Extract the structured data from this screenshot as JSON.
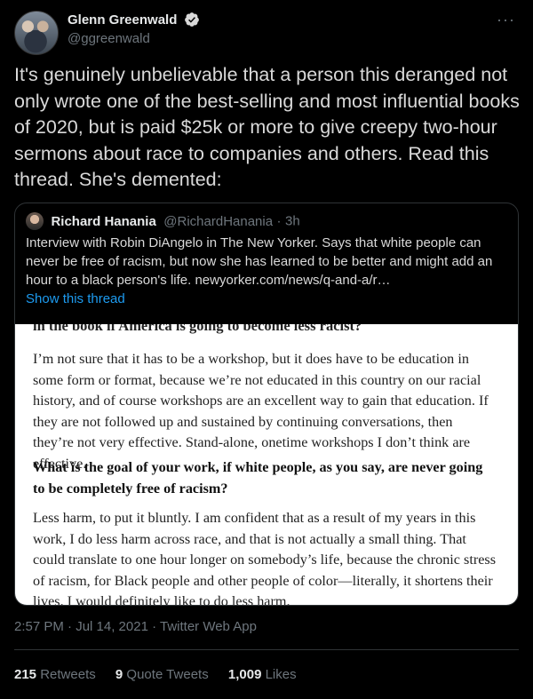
{
  "author": {
    "name": "Glenn Greenwald",
    "handle": "@ggreenwald",
    "verified_icon": "verified-badge-icon"
  },
  "more_label": "···",
  "tweet": {
    "text": "It's genuinely unbelievable that a person this deranged not only wrote one of the best-selling and most influential books of 2020, but is paid $25k or more to give creepy two-hour sermons about race to companies and others. Read this thread. She's demented:"
  },
  "quote": {
    "name": "Richard Hanania",
    "handle": "@RichardHanania",
    "separator": "·",
    "time": "3h",
    "text": "Interview with Robin DiAngelo in The New Yorker. Says that white people can never be free of racism, but now she has learned to be better and might add an hour to a black person's life. newyorker.com/news/q-and-a/r…",
    "show_thread": "Show this thread",
    "image": {
      "cut_heading": "in the book if America is going to become less racist?",
      "para1": "I’m not sure that it has to be a workshop, but it does have to be education in some form or format, because we’re not educated in this country on our racial history, and of course workshops are an excellent way to gain that education. If they are not followed up and sustained by continuing conversations, then they’re not very effective. Stand-alone, onetime workshops I don’t think are effective.",
      "question": "What is the goal of your work, if white people, as you say, are never going to be completely free of racism?",
      "para2": "Less harm, to put it bluntly. I am confident that as a result of my years in this work, I do less harm across race, and that is not actually a small thing. That could translate to one hour longer on somebody’s life, because the chronic stress of racism, for Black people and other people of color—literally, it shortens their lives. I would definitely like to do less harm."
    }
  },
  "meta": "2:57 PM · Jul 14, 2021 · Twitter Web App",
  "stats": {
    "retweets_count": "215",
    "retweets_label": "Retweets",
    "quotes_count": "9",
    "quotes_label": "Quote Tweets",
    "likes_count": "1,009",
    "likes_label": "Likes"
  },
  "colors": {
    "background": "#000000",
    "link": "#1d9bf0",
    "muted": "#6e767d",
    "verified": "#d9d9d9"
  }
}
